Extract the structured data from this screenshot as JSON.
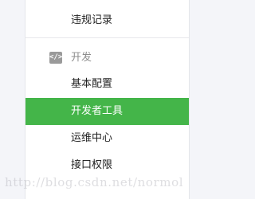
{
  "menu": {
    "violation_records": "违规记录",
    "section_title": "开发",
    "section_icon": "code-tag-icon",
    "section_icon_text": "</>",
    "items": [
      {
        "label": "基本配置",
        "active": false
      },
      {
        "label": "开发者工具",
        "active": true
      },
      {
        "label": "运维中心",
        "active": false
      },
      {
        "label": "接口权限",
        "active": false
      }
    ]
  },
  "watermark": "http://blog.csdn.net/normol",
  "colors": {
    "active_bg": "#44b549",
    "active_text": "#ffffff",
    "text": "#222222",
    "section_text": "#8d8d8d",
    "page_bg": "#f4f5f9"
  }
}
